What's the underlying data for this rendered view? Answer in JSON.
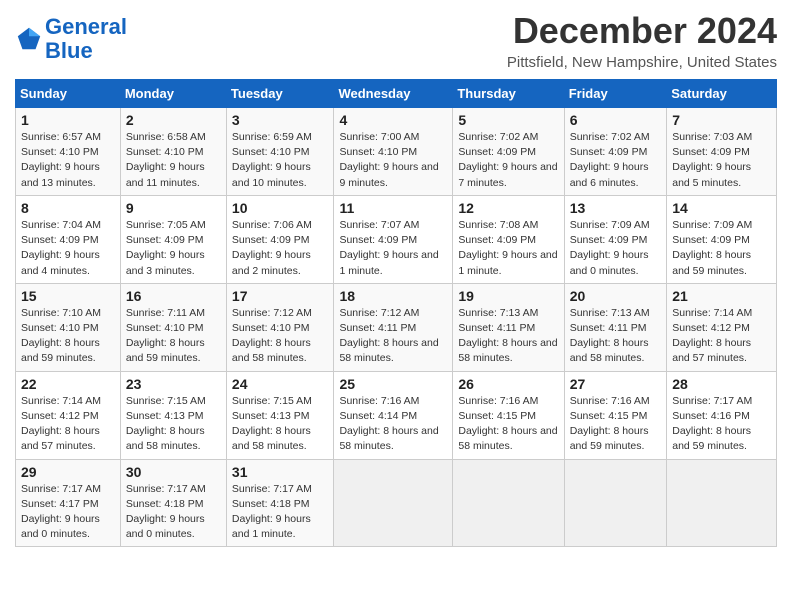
{
  "logo": {
    "line1": "General",
    "line2": "Blue"
  },
  "title": "December 2024",
  "location": "Pittsfield, New Hampshire, United States",
  "days_of_week": [
    "Sunday",
    "Monday",
    "Tuesday",
    "Wednesday",
    "Thursday",
    "Friday",
    "Saturday"
  ],
  "weeks": [
    [
      {
        "day": "1",
        "sunrise": "6:57 AM",
        "sunset": "4:10 PM",
        "daylight": "9 hours and 13 minutes."
      },
      {
        "day": "2",
        "sunrise": "6:58 AM",
        "sunset": "4:10 PM",
        "daylight": "9 hours and 11 minutes."
      },
      {
        "day": "3",
        "sunrise": "6:59 AM",
        "sunset": "4:10 PM",
        "daylight": "9 hours and 10 minutes."
      },
      {
        "day": "4",
        "sunrise": "7:00 AM",
        "sunset": "4:10 PM",
        "daylight": "9 hours and 9 minutes."
      },
      {
        "day": "5",
        "sunrise": "7:02 AM",
        "sunset": "4:09 PM",
        "daylight": "9 hours and 7 minutes."
      },
      {
        "day": "6",
        "sunrise": "7:02 AM",
        "sunset": "4:09 PM",
        "daylight": "9 hours and 6 minutes."
      },
      {
        "day": "7",
        "sunrise": "7:03 AM",
        "sunset": "4:09 PM",
        "daylight": "9 hours and 5 minutes."
      }
    ],
    [
      {
        "day": "8",
        "sunrise": "7:04 AM",
        "sunset": "4:09 PM",
        "daylight": "9 hours and 4 minutes."
      },
      {
        "day": "9",
        "sunrise": "7:05 AM",
        "sunset": "4:09 PM",
        "daylight": "9 hours and 3 minutes."
      },
      {
        "day": "10",
        "sunrise": "7:06 AM",
        "sunset": "4:09 PM",
        "daylight": "9 hours and 2 minutes."
      },
      {
        "day": "11",
        "sunrise": "7:07 AM",
        "sunset": "4:09 PM",
        "daylight": "9 hours and 1 minute."
      },
      {
        "day": "12",
        "sunrise": "7:08 AM",
        "sunset": "4:09 PM",
        "daylight": "9 hours and 1 minute."
      },
      {
        "day": "13",
        "sunrise": "7:09 AM",
        "sunset": "4:09 PM",
        "daylight": "9 hours and 0 minutes."
      },
      {
        "day": "14",
        "sunrise": "7:09 AM",
        "sunset": "4:09 PM",
        "daylight": "8 hours and 59 minutes."
      }
    ],
    [
      {
        "day": "15",
        "sunrise": "7:10 AM",
        "sunset": "4:10 PM",
        "daylight": "8 hours and 59 minutes."
      },
      {
        "day": "16",
        "sunrise": "7:11 AM",
        "sunset": "4:10 PM",
        "daylight": "8 hours and 59 minutes."
      },
      {
        "day": "17",
        "sunrise": "7:12 AM",
        "sunset": "4:10 PM",
        "daylight": "8 hours and 58 minutes."
      },
      {
        "day": "18",
        "sunrise": "7:12 AM",
        "sunset": "4:11 PM",
        "daylight": "8 hours and 58 minutes."
      },
      {
        "day": "19",
        "sunrise": "7:13 AM",
        "sunset": "4:11 PM",
        "daylight": "8 hours and 58 minutes."
      },
      {
        "day": "20",
        "sunrise": "7:13 AM",
        "sunset": "4:11 PM",
        "daylight": "8 hours and 58 minutes."
      },
      {
        "day": "21",
        "sunrise": "7:14 AM",
        "sunset": "4:12 PM",
        "daylight": "8 hours and 57 minutes."
      }
    ],
    [
      {
        "day": "22",
        "sunrise": "7:14 AM",
        "sunset": "4:12 PM",
        "daylight": "8 hours and 57 minutes."
      },
      {
        "day": "23",
        "sunrise": "7:15 AM",
        "sunset": "4:13 PM",
        "daylight": "8 hours and 58 minutes."
      },
      {
        "day": "24",
        "sunrise": "7:15 AM",
        "sunset": "4:13 PM",
        "daylight": "8 hours and 58 minutes."
      },
      {
        "day": "25",
        "sunrise": "7:16 AM",
        "sunset": "4:14 PM",
        "daylight": "8 hours and 58 minutes."
      },
      {
        "day": "26",
        "sunrise": "7:16 AM",
        "sunset": "4:15 PM",
        "daylight": "8 hours and 58 minutes."
      },
      {
        "day": "27",
        "sunrise": "7:16 AM",
        "sunset": "4:15 PM",
        "daylight": "8 hours and 59 minutes."
      },
      {
        "day": "28",
        "sunrise": "7:17 AM",
        "sunset": "4:16 PM",
        "daylight": "8 hours and 59 minutes."
      }
    ],
    [
      {
        "day": "29",
        "sunrise": "7:17 AM",
        "sunset": "4:17 PM",
        "daylight": "9 hours and 0 minutes."
      },
      {
        "day": "30",
        "sunrise": "7:17 AM",
        "sunset": "4:18 PM",
        "daylight": "9 hours and 0 minutes."
      },
      {
        "day": "31",
        "sunrise": "7:17 AM",
        "sunset": "4:18 PM",
        "daylight": "9 hours and 1 minute."
      },
      null,
      null,
      null,
      null
    ]
  ]
}
